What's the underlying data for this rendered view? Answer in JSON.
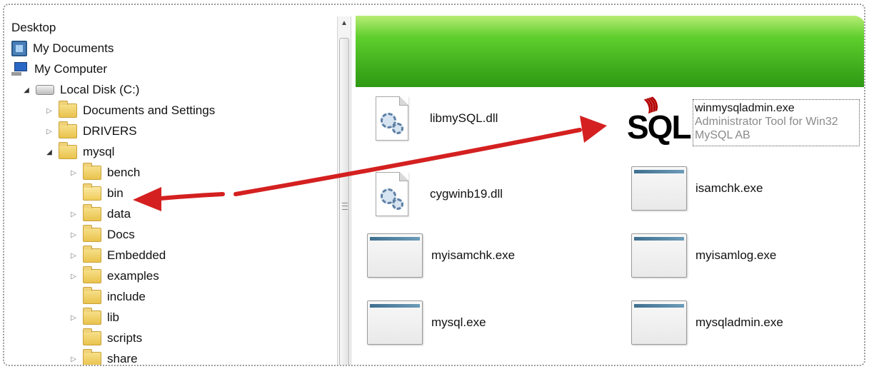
{
  "tree": {
    "desktop": "Desktop",
    "my_documents": "My Documents",
    "my_computer": "My Computer",
    "local_disk": "Local Disk (C:)",
    "documents_and_settings": "Documents and Settings",
    "drivers": "DRIVERS",
    "mysql": "mysql",
    "children": [
      "bench",
      "bin",
      "data",
      "Docs",
      "Embedded",
      "examples",
      "include",
      "lib",
      "scripts",
      "share"
    ]
  },
  "files": {
    "libmysql": "libmySQL.dll",
    "cygwinb19": "cygwinb19.dll",
    "winmysqladmin": "winmysqladmin.exe",
    "winmysqladmin_desc": "Administrator Tool for Win32",
    "winmysqladmin_company": "MySQL AB",
    "isamchk": "isamchk.exe",
    "myisamchk": "myisamchk.exe",
    "myisamlog": "myisamlog.exe",
    "mysql": "mysql.exe",
    "mysqladmin": "mysqladmin.exe"
  },
  "icons": {
    "sql_logo_text": "SQL",
    "expander_collapsed": "▷",
    "expander_open": "◢",
    "scroll_up": "▲"
  },
  "colors": {
    "banner_green": "#3aa71a",
    "arrow_red": "#d42020"
  }
}
